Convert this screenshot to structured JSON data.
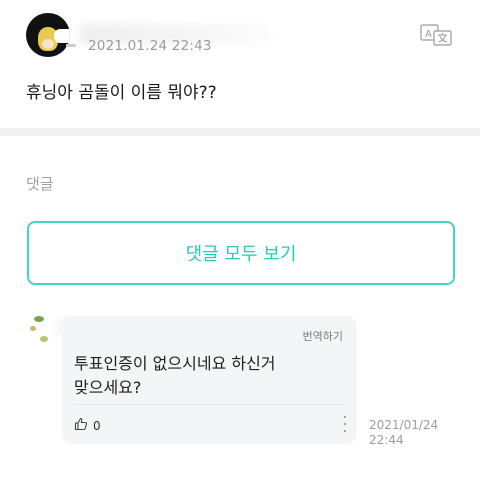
{
  "post": {
    "date": "2021.01.24 22:43",
    "translate_icon": "translate-icon",
    "text": "휴닝아 곰돌이 이름 뭐야??"
  },
  "comments": {
    "section_title": "댓글",
    "view_all_label": "댓글 모두 보기",
    "items": [
      {
        "translate_label": "번역하기",
        "text_line1": "투표인증이 없으시네요 하신거",
        "text_line2": "맞으세요?",
        "like_icon": "thumbs-up-icon",
        "like_count": "0",
        "more_icon": "more-vertical-icon",
        "time_date": "2021/01/24",
        "time_clock": "22:44"
      }
    ]
  },
  "colors": {
    "accent": "#27cbb6",
    "accent_border": "#3fd6c4",
    "muted_text": "#9a9a9a",
    "bubble_bg": "#f4f5f7",
    "divider": "#f1f1f3"
  }
}
